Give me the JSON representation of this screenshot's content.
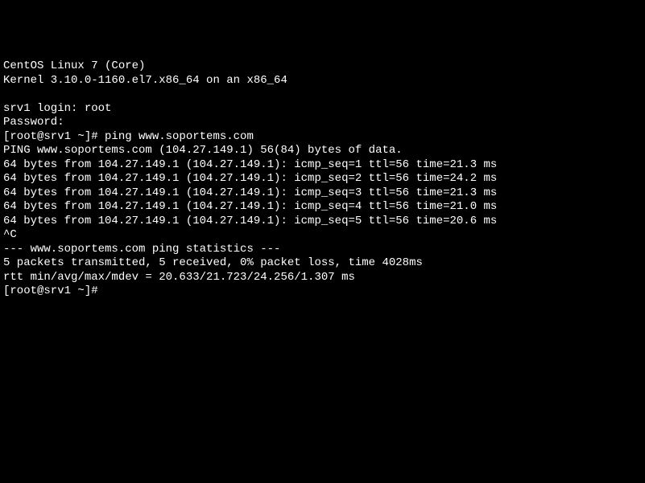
{
  "os_header": {
    "line1": "CentOS Linux 7 (Core)",
    "line2": "Kernel 3.10.0-1160.el7.x86_64 on an x86_64"
  },
  "login": {
    "prompt": "srv1 login: root",
    "password_prompt": "Password:"
  },
  "command": {
    "prompt": "[root@srv1 ~]# ping www.soportems.com"
  },
  "ping_output": {
    "header": "PING www.soportems.com (104.27.149.1) 56(84) bytes of data.",
    "replies": [
      "64 bytes from 104.27.149.1 (104.27.149.1): icmp_seq=1 ttl=56 time=21.3 ms",
      "64 bytes from 104.27.149.1 (104.27.149.1): icmp_seq=2 ttl=56 time=24.2 ms",
      "64 bytes from 104.27.149.1 (104.27.149.1): icmp_seq=3 ttl=56 time=21.3 ms",
      "64 bytes from 104.27.149.1 (104.27.149.1): icmp_seq=4 ttl=56 time=21.0 ms",
      "64 bytes from 104.27.149.1 (104.27.149.1): icmp_seq=5 ttl=56 time=20.6 ms"
    ],
    "interrupt": "^C",
    "stats_header": "--- www.soportems.com ping statistics ---",
    "stats_line1": "5 packets transmitted, 5 received, 0% packet loss, time 4028ms",
    "stats_line2": "rtt min/avg/max/mdev = 20.633/21.723/24.256/1.307 ms"
  },
  "final_prompt": "[root@srv1 ~]# "
}
